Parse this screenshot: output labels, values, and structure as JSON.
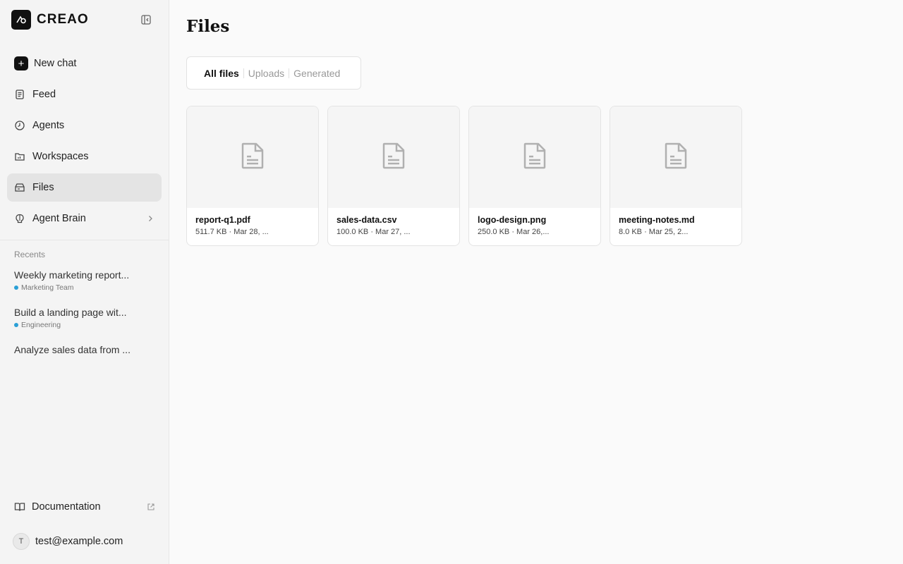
{
  "brand": {
    "name": "CREAO",
    "logo_icon": "creao-logo-icon"
  },
  "sidebar": {
    "collapse_icon": "sidebar-collapse-icon",
    "nav": [
      {
        "label": "New chat",
        "icon": "plus-icon"
      },
      {
        "label": "Feed",
        "icon": "feed-icon"
      },
      {
        "label": "Agents",
        "icon": "agents-icon"
      },
      {
        "label": "Workspaces",
        "icon": "workspaces-icon"
      },
      {
        "label": "Files",
        "icon": "files-icon",
        "active": true
      },
      {
        "label": "Agent Brain",
        "icon": "brain-icon",
        "chevron": "chevron-right-icon"
      }
    ],
    "recents_label": "Recents",
    "recents": [
      {
        "title": "Weekly marketing report...",
        "tag": "Marketing Team",
        "tag_color": "#2a9fd6"
      },
      {
        "title": "Build a landing page wit...",
        "tag": "Engineering",
        "tag_color": "#2a9fd6"
      },
      {
        "title": "Analyze sales data from ...",
        "tag": ""
      }
    ],
    "docs_label": "Documentation",
    "user": {
      "initial": "T",
      "email": "test@example.com"
    }
  },
  "main": {
    "title": "Files",
    "tabs": [
      {
        "label": "All files",
        "active": true
      },
      {
        "label": "Uploads"
      },
      {
        "label": "Generated"
      }
    ],
    "files": [
      {
        "name": "report-q1.pdf",
        "meta": "511.7 KB · Mar 28, ...",
        "icon": "document-icon"
      },
      {
        "name": "sales-data.csv",
        "meta": "100.0 KB · Mar 27, ...",
        "icon": "document-icon"
      },
      {
        "name": "logo-design.png",
        "meta": "250.0 KB · Mar 26,...",
        "icon": "document-icon"
      },
      {
        "name": "meeting-notes.md",
        "meta": "8.0 KB · Mar 25, 2...",
        "icon": "document-icon"
      }
    ]
  },
  "colors": {
    "accent": "#111111",
    "tag_dot": "#2a9fd6",
    "sidebar_bg": "#f4f4f4",
    "active_bg": "#e4e4e4"
  }
}
